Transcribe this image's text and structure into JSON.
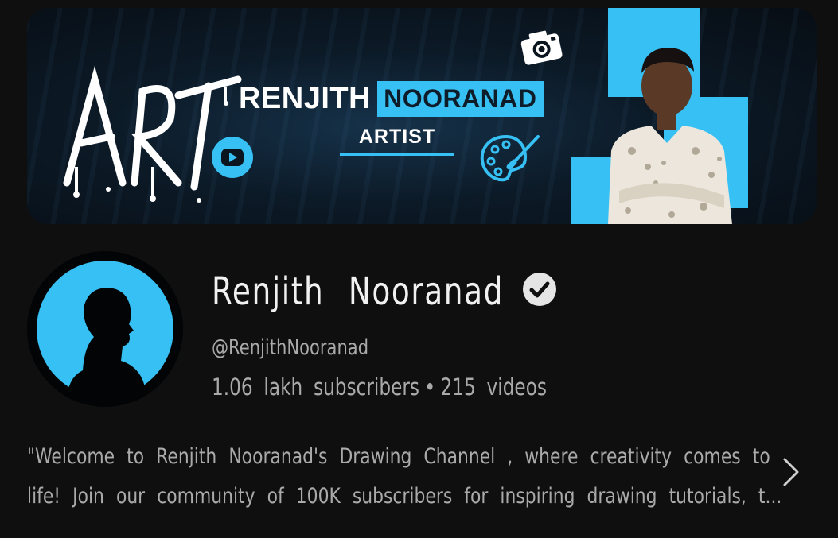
{
  "banner": {
    "art_text": "ART",
    "name_first": "RENJITH",
    "name_second": "NOORANAD",
    "tagline": "ARTIST",
    "accent_color": "#37c0f3",
    "icons": [
      "youtube-icon",
      "camera-icon",
      "palette-icon"
    ]
  },
  "channel": {
    "name": "Renjith Nooranad",
    "verified": true,
    "handle": "@RenjithNooranad",
    "subscribers": "1.06 lakh subscribers",
    "separator": "•",
    "videos": "215 videos",
    "description_line1": "\"Welcome to Renjith Nooranad's Drawing Channel , where creativity comes to",
    "description_line2": "life! Join our community of 100K subscribers for inspiring drawing tutorials, t..."
  },
  "colors": {
    "background": "#0f0f0f",
    "text_primary": "#f1f1f1",
    "text_secondary": "#aaaaaa",
    "avatar_ring": "#37c0f3"
  }
}
